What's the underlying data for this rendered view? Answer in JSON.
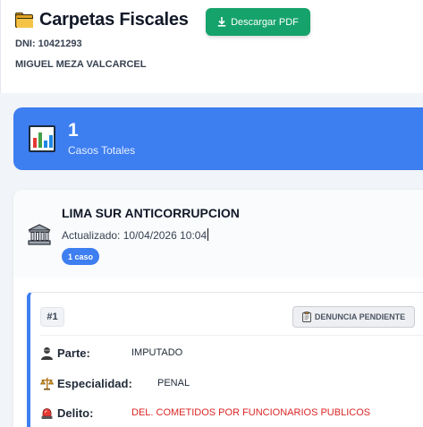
{
  "header": {
    "title": "Carpetas Fiscales",
    "pdf_button": "Descargar PDF",
    "dni": "DNI: 10421293",
    "name": "MIGUEL MEZA VALCARCEL"
  },
  "stats": {
    "value": "1",
    "label": "Casos Totales"
  },
  "office": {
    "name": "LIMA SUR ANTICORRUPCION",
    "updated": "Actualizado: 10/04/2026 10:04",
    "count_badge": "1 caso"
  },
  "case": {
    "number": "#1",
    "status": "DENUNCIA PENDIENTE",
    "fields": {
      "parte": {
        "label": "Parte:",
        "value": "IMPUTADO"
      },
      "especialidad": {
        "label": "Especialidad:",
        "value": "PENAL"
      },
      "delito": {
        "label": "Delito:",
        "value": "DEL. COMETIDOS POR FUNCIONARIOS PUBLICOS"
      }
    }
  },
  "colors": {
    "accent_blue": "#3d7ef0",
    "success_green": "#16a36b",
    "danger_red": "#dc2626"
  },
  "icons": [
    "folder-icon",
    "download-icon",
    "bar-chart-icon",
    "bank-icon",
    "clipboard-icon",
    "person-icon",
    "scales-icon",
    "siren-icon"
  ]
}
